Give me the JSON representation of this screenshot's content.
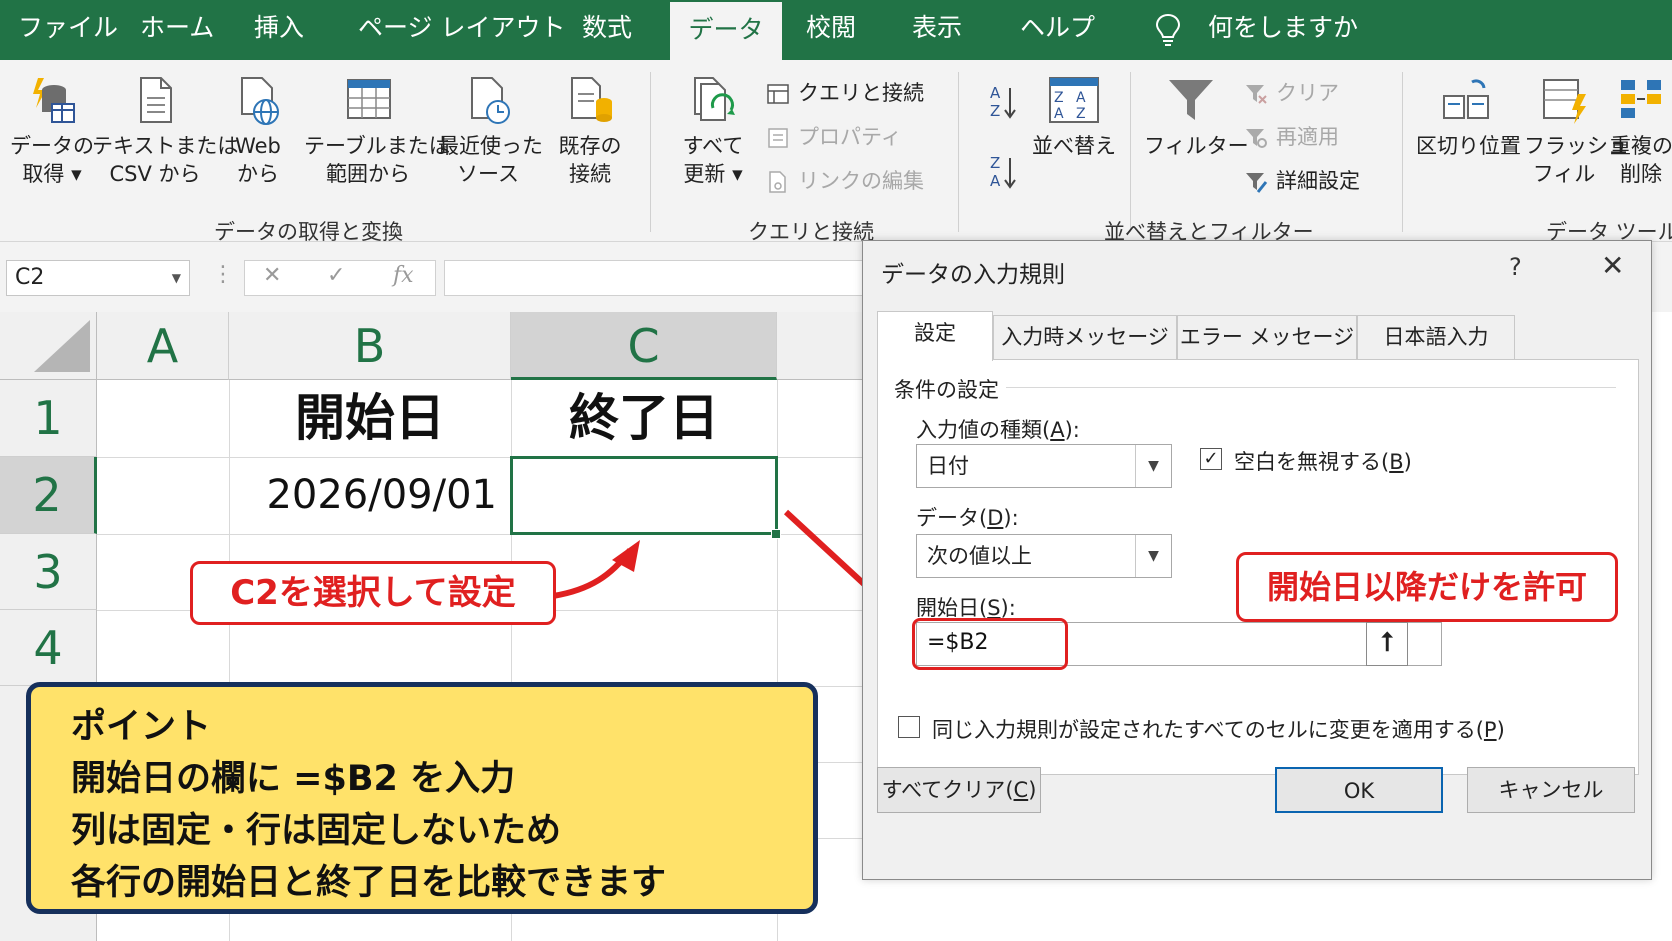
{
  "ribbon_tabs": [
    {
      "label": "ファイル"
    },
    {
      "label": "ホーム"
    },
    {
      "label": "挿入"
    },
    {
      "label": "ページ レイアウト"
    },
    {
      "label": "数式"
    },
    {
      "label": "データ"
    },
    {
      "label": "校閲"
    },
    {
      "label": "表示"
    },
    {
      "label": "ヘルプ"
    }
  ],
  "tell_me": "何をしますか",
  "ribbon": {
    "get_data": {
      "line1": "データの",
      "line2": "取得 ▾"
    },
    "text_csv": {
      "line1": "テキストまたは",
      "line2": "CSV から"
    },
    "web": {
      "line1": "Web",
      "line2": "から"
    },
    "table_range": {
      "line1": "テーブルまたは",
      "line2": "範囲から"
    },
    "recent": {
      "line1": "最近使った",
      "line2": "ソース"
    },
    "existing": {
      "line1": "既存の",
      "line2": "接続"
    },
    "group1": "データの取得と変換",
    "refresh_all": {
      "line1": "すべて",
      "line2": "更新 ▾"
    },
    "queries": "クエリと接続",
    "properties": "プロパティ",
    "edit_links": "リンクの編集",
    "group2": "クエリと接続",
    "sort": "並べ替え",
    "filter": "フィルター",
    "clear": "クリア",
    "reapply": "再適用",
    "advanced": "詳細設定",
    "group3": "並べ替えとフィルター",
    "text_to_columns": "区切り位置",
    "flash_fill": {
      "line1": "フラッシュ",
      "line2": "フィル"
    },
    "remove_dup": {
      "line1": "重複の",
      "line2": "削除"
    },
    "group4": "データ ツール"
  },
  "formula_bar": {
    "name_box": "C2",
    "cancel": "✕",
    "enter": "✓",
    "fx": "fx"
  },
  "sheet": {
    "columns": [
      "A",
      "B",
      "C"
    ],
    "rows": [
      "1",
      "2",
      "3",
      "4"
    ],
    "B1": "開始日",
    "C1": "終了日",
    "B2": "2026/09/01",
    "C2": ""
  },
  "callouts": {
    "select_c2": "C2を選択して設定",
    "allow_after": "開始日以降だけを許可"
  },
  "point": {
    "title": "ポイント",
    "lines": [
      "開始日の欄に =$B2 を入力",
      "列は固定・行は固定しないため",
      "各行の開始日と終了日を比較できます"
    ]
  },
  "dialog": {
    "title": "データの入力規則",
    "help": "?",
    "close": "✕",
    "tabs": [
      "設定",
      "入力時メッセージ",
      "エラー メッセージ",
      "日本語入力"
    ],
    "section": "条件の設定",
    "allow_label": "入力値の種類",
    "allow_key": "A",
    "allow_value": "日付",
    "ignore_blank_label": "空白を無視する",
    "ignore_blank_key": "B",
    "ignore_blank_checked": true,
    "data_label": "データ",
    "data_key": "D",
    "data_value": "次の値以上",
    "start_label": "開始日",
    "start_key": "S",
    "start_value": "=$B2",
    "apply_all_label": "同じ入力規則が設定されたすべてのセルに変更を適用する",
    "apply_all_key": "P",
    "apply_all_checked": false,
    "clear_all_label": "すべてクリア",
    "clear_all_key": "C",
    "ok": "OK",
    "cancel": "キャンセル"
  },
  "colors": {
    "excel_green": "#217346",
    "callout_red": "#e02020",
    "point_bg": "#ffe26a",
    "point_border": "#16305c"
  }
}
